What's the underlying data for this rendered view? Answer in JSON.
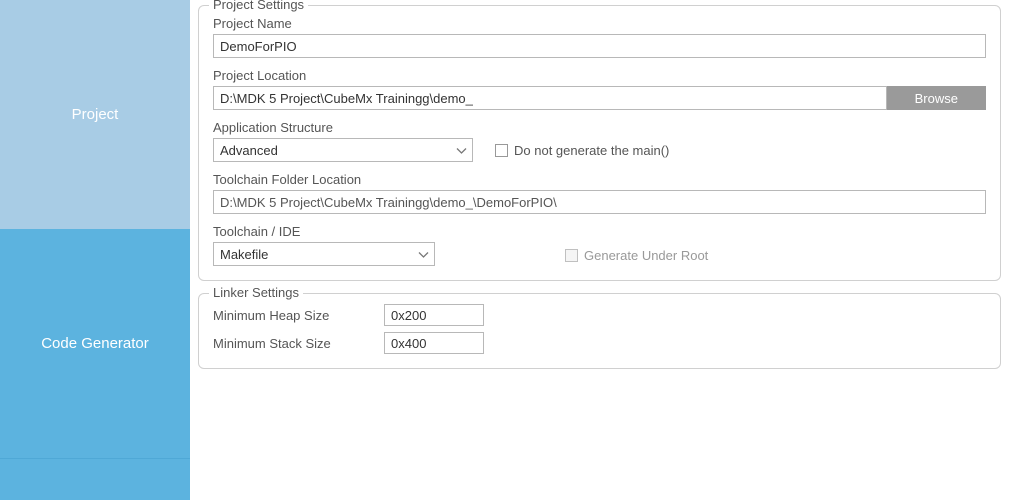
{
  "sidebar": {
    "items": [
      {
        "label": "Project"
      },
      {
        "label": "Code Generator"
      },
      {
        "label": ""
      }
    ]
  },
  "project_settings": {
    "legend": "Project Settings",
    "project_name": {
      "label": "Project Name",
      "value": "DemoForPIO"
    },
    "project_location": {
      "label": "Project Location",
      "value": "D:\\MDK 5 Project\\CubeMx Trainingg\\demo_",
      "browse": "Browse"
    },
    "app_structure": {
      "label": "Application Structure",
      "value": "Advanced",
      "no_main_label": "Do not generate the main()"
    },
    "toolchain_folder": {
      "label": "Toolchain Folder Location",
      "value": "D:\\MDK 5 Project\\CubeMx Trainingg\\demo_\\DemoForPIO\\"
    },
    "toolchain_ide": {
      "label": "Toolchain / IDE",
      "value": "Makefile",
      "generate_under_root_label": "Generate Under Root"
    }
  },
  "linker_settings": {
    "legend": "Linker Settings",
    "heap": {
      "label": "Minimum Heap Size",
      "value": "0x200"
    },
    "stack": {
      "label": "Minimum Stack Size",
      "value": "0x400"
    }
  }
}
